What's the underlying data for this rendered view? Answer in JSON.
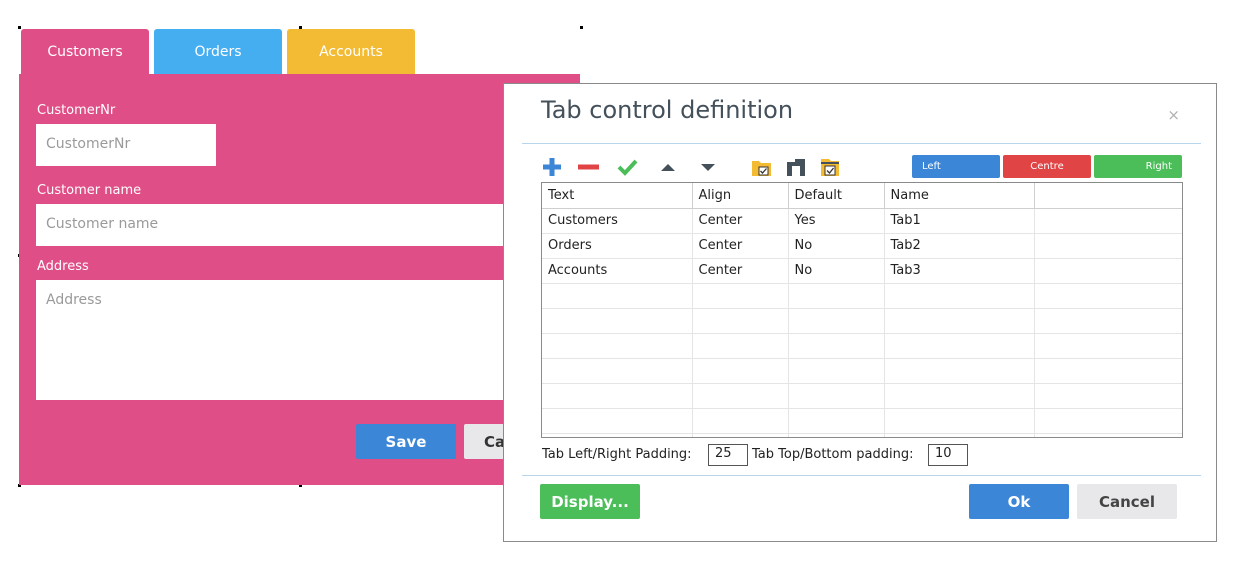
{
  "form": {
    "tabs": [
      {
        "label": "Customers",
        "color": "#e04e87"
      },
      {
        "label": "Orders",
        "color": "#45aef1"
      },
      {
        "label": "Accounts",
        "color": "#f3bb33"
      }
    ],
    "fields": {
      "customer_nr": {
        "label": "CustomerNr",
        "placeholder": "CustomerNr"
      },
      "customer_name": {
        "label": "Customer name",
        "placeholder": "Customer name"
      },
      "address": {
        "label": "Address",
        "placeholder": "Address"
      }
    },
    "save_label": "Save",
    "cancel_label_partial": "Ca"
  },
  "dialog": {
    "title": "Tab control definition",
    "close_symbol": "×",
    "toolbar": {
      "icons": [
        "add-icon",
        "remove-icon",
        "confirm-icon",
        "move-up-icon",
        "move-down-icon",
        "open-folder-icon",
        "tab-icon",
        "folder-checked-icon"
      ],
      "align_left": "Left",
      "align_centre": "Centre",
      "align_right": "Right"
    },
    "grid": {
      "columns": [
        "Text",
        "Align",
        "Default",
        "Name",
        ""
      ],
      "rows": [
        [
          "Customers",
          "Center",
          "Yes",
          "Tab1",
          ""
        ],
        [
          "Orders",
          "Center",
          "No",
          "Tab2",
          ""
        ],
        [
          "Accounts",
          "Center",
          "No",
          "Tab3",
          ""
        ]
      ]
    },
    "padding": {
      "left_right_label": "Tab Left/Right Padding:",
      "left_right_value": "25",
      "top_bottom_label": "Tab Top/Bottom padding:",
      "top_bottom_value": "10"
    },
    "display_label": "Display...",
    "ok_label": "Ok",
    "cancel_label": "Cancel"
  },
  "colors": {
    "blue": "#3b86d6",
    "red": "#e04444",
    "green": "#4bbd59",
    "pink": "#e04e87",
    "light_blue": "#45aef1",
    "yellow": "#f3bb33"
  }
}
